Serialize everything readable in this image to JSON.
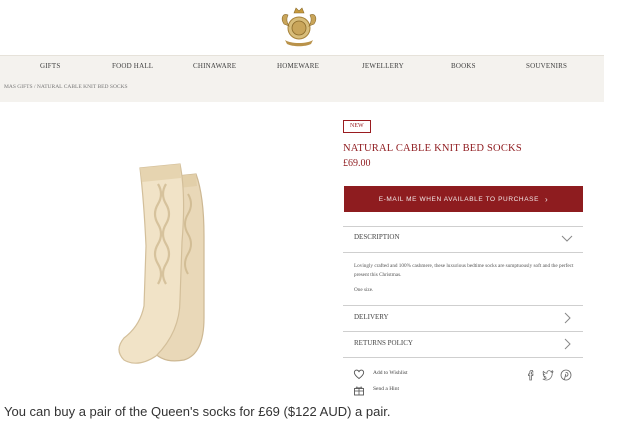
{
  "brand": {
    "logo_icon": "royal-crest-icon",
    "logo_color": "#b5924a"
  },
  "nav": {
    "items": [
      "GIFTS",
      "FOOD HALL",
      "CHINAWARE",
      "HOMEWARE",
      "JEWELLERY",
      "BOOKS",
      "SOUVENIRS"
    ]
  },
  "breadcrumb": "MAS GIFTS / NATURAL CABLE KNIT BED SOCKS",
  "product": {
    "badge": "NEW",
    "title": "NATURAL CABLE KNIT BED SOCKS",
    "price": "£69.00",
    "cta_label": "E-MAIL ME WHEN AVAILABLE TO PURCHASE",
    "cta_icon": "chevron-right-icon",
    "accent_color": "#8e1c1f"
  },
  "accordion": {
    "description_label": "DESCRIPTION",
    "description_text": "Lovingly crafted and 100% cashmere, these luxurious bedtime socks are sumptuously soft and the perfect present this Christmas.",
    "description_size": "One size.",
    "delivery_label": "DELIVERY",
    "returns_label": "RETURNS POLICY"
  },
  "actions": {
    "wishlist": "Add to Wishlist",
    "hint": "Send a Hint"
  },
  "social_icons": [
    "facebook-icon",
    "twitter-icon",
    "pinterest-icon"
  ],
  "caption": "You can buy a pair of the Queen's socks for £69 ($122 AUD) a pair."
}
